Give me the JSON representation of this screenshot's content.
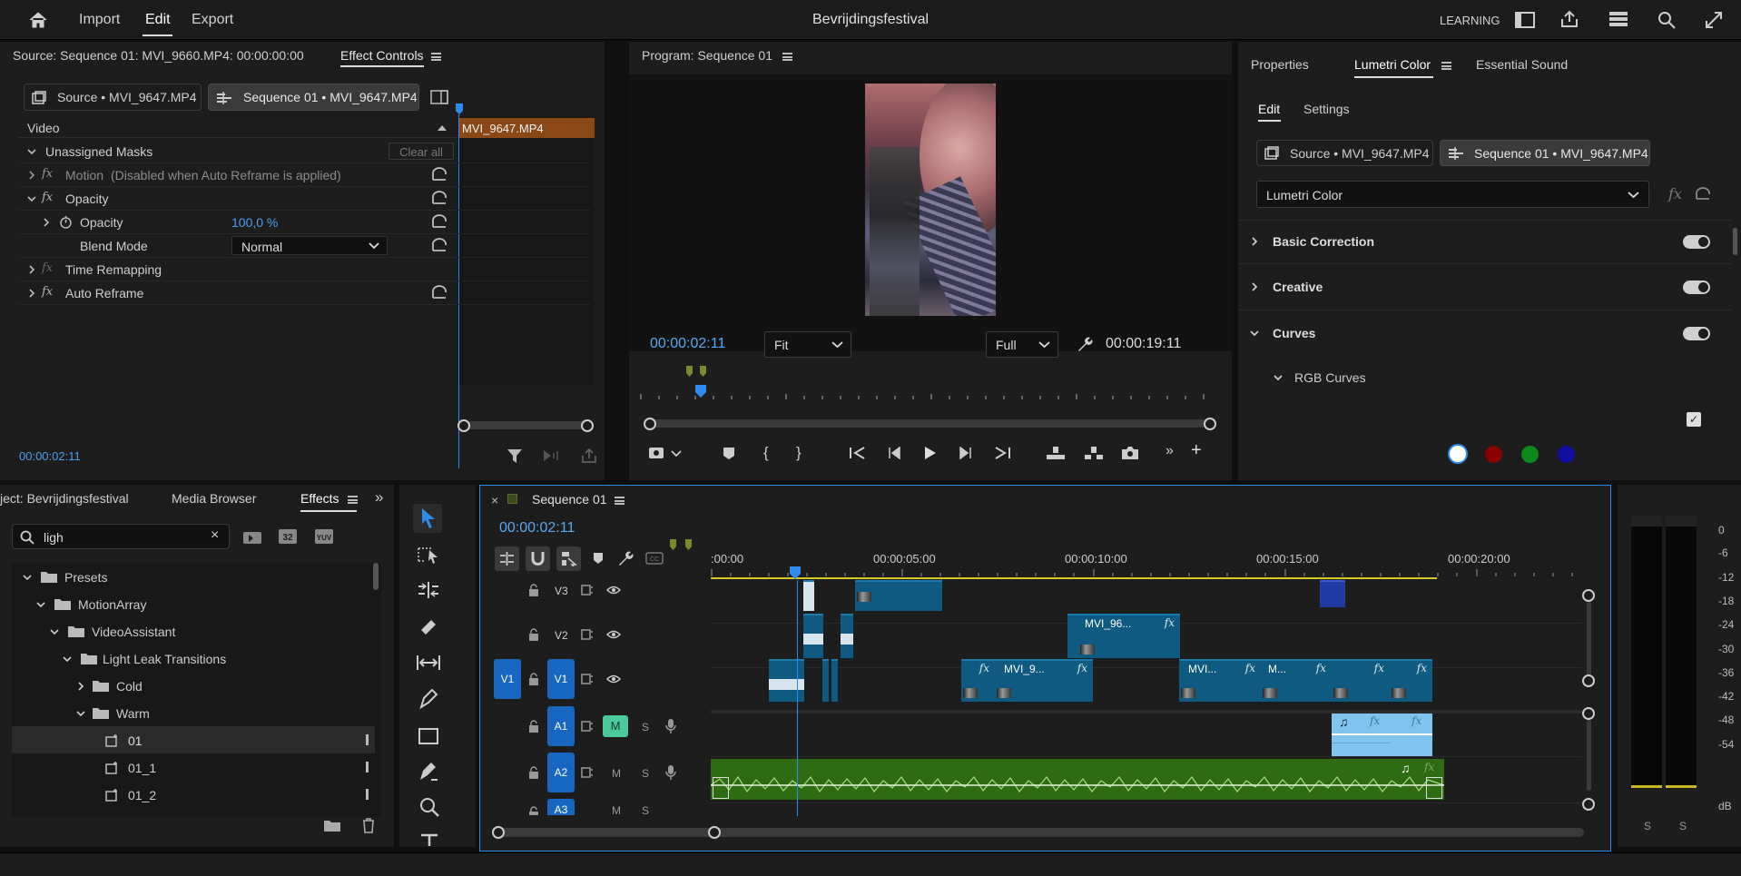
{
  "topbar": {
    "menu": [
      "Import",
      "Edit",
      "Export"
    ],
    "project_title": "Bevrijdingsfestival",
    "learning": "LEARNING"
  },
  "effect_controls": {
    "source_label": "Source: Sequence 01: MVI_9660.MP4: 00:00:00:00",
    "tab": "Effect Controls",
    "source_chip": "Source • MVI_9647.MP4",
    "sequence_chip": "Sequence 01 • MVI_9647.MP4",
    "video_header": "Video",
    "clip_label": "MVI_9647.MP4",
    "rows": {
      "unassigned_masks": "Unassigned Masks",
      "clear_all": "Clear all",
      "motion": "Motion",
      "motion_note": "(Disabled when Auto Reframe is applied)",
      "opacity_group": "Opacity",
      "opacity": "Opacity",
      "opacity_value": "100,0 %",
      "blend_mode": "Blend Mode",
      "blend_value": "Normal",
      "time_remapping": "Time Remapping",
      "auto_reframe": "Auto Reframe"
    },
    "timecode": "00:00:02:11"
  },
  "program": {
    "title": "Program: Sequence 01",
    "timecode": "00:00:02:11",
    "fit": "Fit",
    "quality": "Full",
    "duration": "00:00:19:11"
  },
  "lumetri": {
    "tabs": [
      "Properties",
      "Lumetri Color",
      "Essential Sound"
    ],
    "subtabs": [
      "Edit",
      "Settings"
    ],
    "source_chip": "Source • MVI_9647.MP4",
    "sequence_chip": "Sequence 01 • MVI_9647.MP4",
    "effect_select": "Lumetri Color",
    "sections": [
      "Basic Correction",
      "Creative",
      "Curves"
    ],
    "rgb_curves": "RGB Curves",
    "channel_colors": [
      "#ffffff",
      "#8b0000",
      "#0a8a1a",
      "#1010a0"
    ]
  },
  "effects_panel": {
    "tabs": [
      "ject: Bevrijdingsfestival",
      "Media Browser",
      "Effects"
    ],
    "search_value": "ligh",
    "tree": [
      "Presets",
      "MotionArray",
      "VideoAssistant",
      "Light Leak Transitions",
      "Cold",
      "Warm",
      "01",
      "01_1",
      "01_2"
    ]
  },
  "timeline": {
    "sequence_name": "Sequence 01",
    "timecode": "00:00:02:11",
    "ruler": [
      ":00:00",
      "00:00:05:00",
      "00:00:10:00",
      "00:00:15:00",
      "00:00:20:00"
    ],
    "tracks": {
      "v3": "V3",
      "v2": "V2",
      "v1_src": "V1",
      "v1": "V1",
      "a1": "A1",
      "a2": "A2",
      "a3": "A3",
      "m": "M",
      "s": "S"
    },
    "clips": {
      "v2": "MVI_96...",
      "v1a": "MVI_9...",
      "v1b": "MVI...",
      "v1c": "M..."
    }
  },
  "meter": {
    "scale": [
      "0",
      "-6",
      "-12",
      "-18",
      "-24",
      "-30",
      "-36",
      "-42",
      "-48",
      "-54",
      "dB"
    ],
    "solo": [
      "S",
      "S"
    ]
  }
}
